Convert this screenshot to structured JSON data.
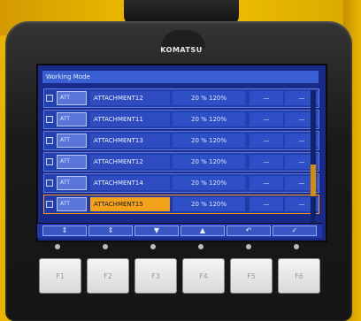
{
  "device": {
    "brand": "KOMATSU"
  },
  "screen": {
    "title": "Working Mode",
    "rows": [
      {
        "name": "ATTACHMENT12",
        "flow": "20 %  120%",
        "d1": "—",
        "d2": "—",
        "checked": true
      },
      {
        "name": "ATTACHMENT11",
        "flow": "20 %  120%",
        "d1": "—",
        "d2": "—",
        "checked": false
      },
      {
        "name": "ATTACHMENT13",
        "flow": "20 %  120%",
        "d1": "—",
        "d2": "—",
        "checked": false
      },
      {
        "name": "ATTACHMENT12",
        "flow": "20 %  120%",
        "d1": "—",
        "d2": "—",
        "checked": false
      },
      {
        "name": "ATTACHMENT14",
        "flow": "20 %  120%",
        "d1": "—",
        "d2": "—",
        "checked": false
      },
      {
        "name": "ATTACHMENT15",
        "flow": "20 %  120%",
        "d1": "—",
        "d2": "—",
        "checked": false,
        "selected": true
      }
    ],
    "fkeys": [
      "⇕",
      "⇕",
      "▼",
      "▲",
      "↶",
      "✓"
    ]
  },
  "panel": {
    "buttons": [
      "F1",
      "F2",
      "F3",
      "F4",
      "F5",
      "F6"
    ]
  }
}
